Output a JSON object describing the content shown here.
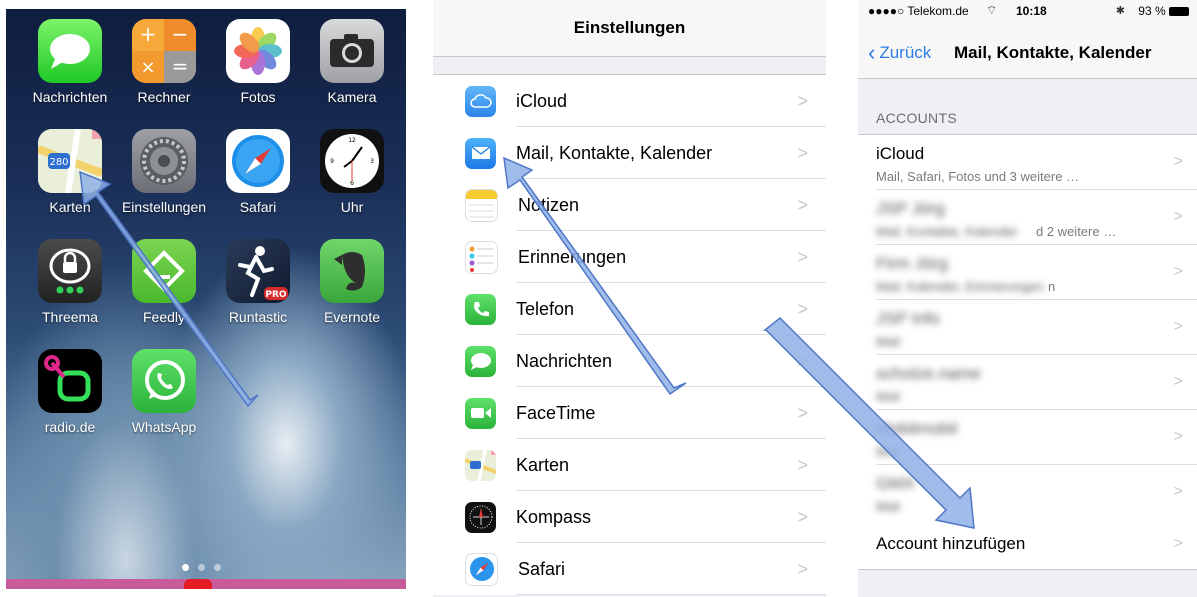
{
  "home": {
    "apps": [
      {
        "label": "Nachrichten",
        "icon": "messages-icon"
      },
      {
        "label": "Rechner",
        "icon": "calculator-icon"
      },
      {
        "label": "Fotos",
        "icon": "photos-icon"
      },
      {
        "label": "Kamera",
        "icon": "camera-icon"
      },
      {
        "label": "Karten",
        "icon": "maps-icon"
      },
      {
        "label": "Einstellungen",
        "icon": "settings-icon"
      },
      {
        "label": "Safari",
        "icon": "safari-icon"
      },
      {
        "label": "Uhr",
        "icon": "clock-icon"
      },
      {
        "label": "Threema",
        "icon": "threema-icon"
      },
      {
        "label": "Feedly",
        "icon": "feedly-icon"
      },
      {
        "label": "Runtastic",
        "icon": "runtastic-icon"
      },
      {
        "label": "Evernote",
        "icon": "evernote-icon"
      },
      {
        "label": "radio.de",
        "icon": "radio-icon"
      },
      {
        "label": "WhatsApp",
        "icon": "whatsapp-icon"
      }
    ],
    "maps_badge": "280",
    "runtastic_badge": "PRO"
  },
  "settings": {
    "title": "Einstellungen",
    "items": [
      {
        "label": "iCloud",
        "icon": "icloud-icon"
      },
      {
        "label": "Mail, Kontakte, Kalender",
        "icon": "mail-icon"
      },
      {
        "label": "Notizen",
        "icon": "notes-icon"
      },
      {
        "label": "Erinnerungen",
        "icon": "reminders-icon"
      },
      {
        "label": "Telefon",
        "icon": "phone-icon"
      },
      {
        "label": "Nachrichten",
        "icon": "messages-icon"
      },
      {
        "label": "FaceTime",
        "icon": "facetime-icon"
      },
      {
        "label": "Karten",
        "icon": "maps-icon"
      },
      {
        "label": "Kompass",
        "icon": "compass-icon"
      },
      {
        "label": "Safari",
        "icon": "safari-icon"
      }
    ]
  },
  "mail": {
    "status": {
      "carrier": "●●●●○ Telekom.de",
      "wifi": "wifi-icon",
      "time": "10:18",
      "battery": "93 %",
      "bluetooth": "bluetooth-icon"
    },
    "back_label": "Zurück",
    "title": "Mail, Kontakte, Kalender",
    "section": "ACCOUNTS",
    "accounts": [
      {
        "name": "iCloud",
        "sub": "Mail, Safari, Fotos und 3 weitere …",
        "blurred": false
      },
      {
        "name": "JSP Jörg",
        "sub": "Mail, Kontakte, Kalender",
        "tail": "d 2 weitere …",
        "blurred": true
      },
      {
        "name": "Firm Jörg",
        "sub": "Mail, Kalender, Erinnerungen",
        "tail": "n",
        "blurred": true
      },
      {
        "name": "JSP Info",
        "sub": "Mail",
        "blurred": true
      },
      {
        "name": "scholze.name",
        "sub": "Mail",
        "blurred": true
      },
      {
        "name": "Mobilmobil",
        "sub": "Mail",
        "blurred": true
      },
      {
        "name": "GMX",
        "sub": "Mail",
        "blurred": true
      }
    ],
    "add_label": "Account hinzufügen"
  },
  "colors": {
    "ios_blue": "#2f7de1",
    "arrow_fill": "#8fb0e6",
    "arrow_stroke": "#4f77c6"
  }
}
